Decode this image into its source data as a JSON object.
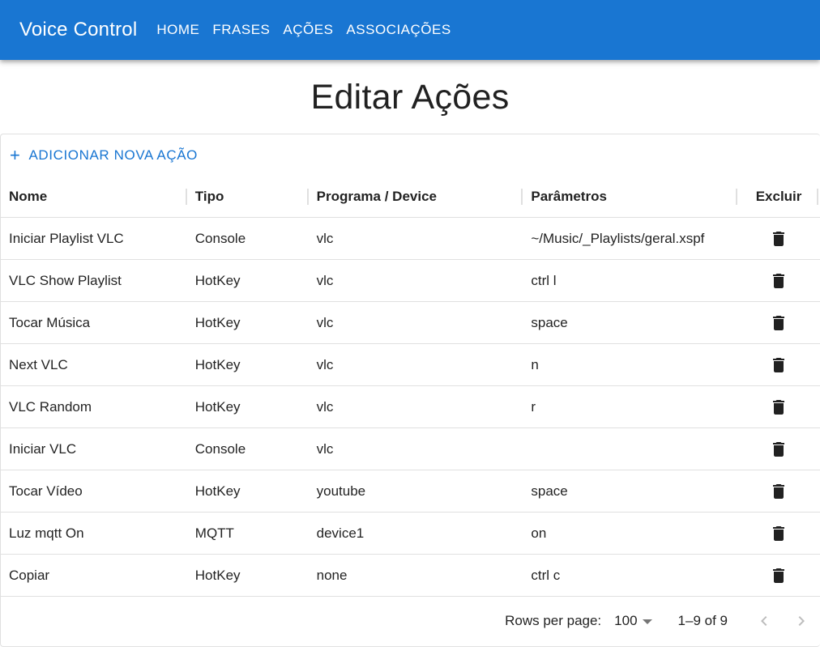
{
  "appbar": {
    "title": "Voice Control",
    "nav": [
      "HOME",
      "FRASES",
      "AÇÕES",
      "ASSOCIAÇÕES"
    ]
  },
  "page": {
    "title": "Editar Ações"
  },
  "toolbar": {
    "add_label": "ADICIONAR NOVA AÇÃO",
    "add_icon": "plus-icon"
  },
  "table": {
    "columns": [
      "Nome",
      "Tipo",
      "Programa / Device",
      "Parâmetros",
      "Excluir"
    ],
    "rows": [
      [
        "Iniciar Playlist VLC",
        "Console",
        "vlc",
        "~/Music/_Playlists/geral.xspf"
      ],
      [
        "VLC Show Playlist",
        "HotKey",
        "vlc",
        "ctrl l"
      ],
      [
        "Tocar Música",
        "HotKey",
        "vlc",
        "space"
      ],
      [
        "Next VLC",
        "HotKey",
        "vlc",
        "n"
      ],
      [
        "VLC Random",
        "HotKey",
        "vlc",
        "r"
      ],
      [
        "Iniciar VLC",
        "Console",
        "vlc",
        ""
      ],
      [
        "Tocar Vídeo",
        "HotKey",
        "youtube",
        "space"
      ],
      [
        "Luz mqtt On",
        "MQTT",
        "device1",
        "on"
      ],
      [
        "Copiar",
        "HotKey",
        "none",
        "ctrl c"
      ]
    ],
    "delete_icon": "trash-icon"
  },
  "pagination": {
    "rows_per_page_label": "Rows per page:",
    "rows_per_page_value": "100",
    "range": "1–9 of 9"
  },
  "colors": {
    "primary": "#1976d2",
    "divider": "#e0e0e0",
    "text": "#212121"
  }
}
